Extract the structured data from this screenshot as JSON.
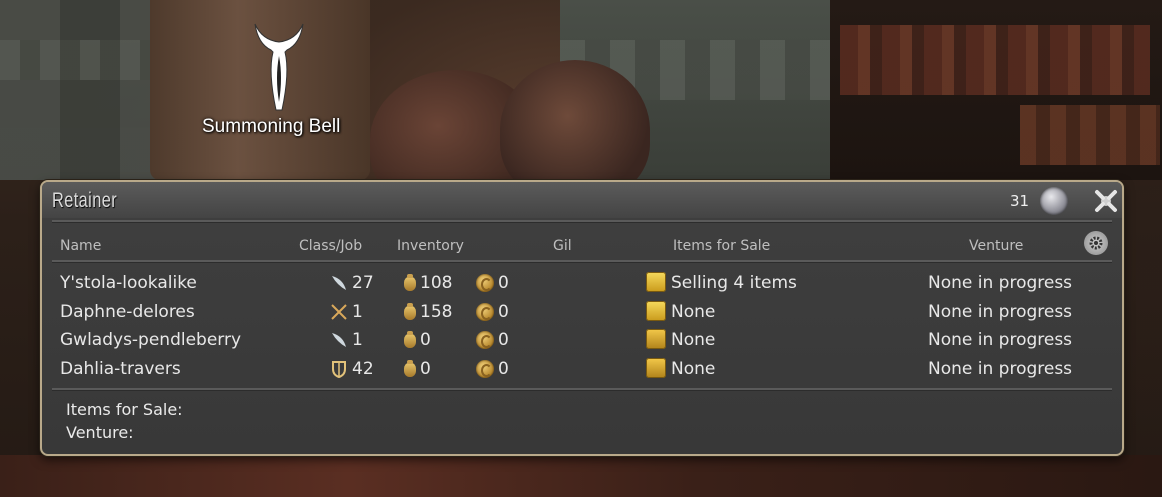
{
  "world": {
    "npc_label": "Summoning Bell"
  },
  "window": {
    "title": "Retainer",
    "retainer_count": "31",
    "icons": {
      "close": "close-icon",
      "coin": "silver-coin-icon",
      "settings": "gear-icon"
    },
    "columns": {
      "name": "Name",
      "class_job": "Class/Job",
      "inventory": "Inventory",
      "gil": "Gil",
      "items_for_sale": "Items for Sale",
      "venture": "Venture"
    },
    "rows": [
      {
        "name": "Y'stola-lookalike",
        "job_icon": "quill-icon",
        "level": "27",
        "inventory": "108",
        "gil": "0",
        "sale_icon": "market-icon",
        "items_for_sale": "Selling 4 items",
        "venture": "None in progress"
      },
      {
        "name": "Daphne-delores",
        "job_icon": "crossed-swords-icon",
        "level": "1",
        "inventory": "158",
        "gil": "0",
        "sale_icon": "market-icon",
        "items_for_sale": "None",
        "venture": "None in progress"
      },
      {
        "name": "Gwladys-pendleberry",
        "job_icon": "quill-icon",
        "level": "1",
        "inventory": "0",
        "gil": "0",
        "sale_icon": "scale-icon",
        "items_for_sale": "None",
        "venture": "None in progress"
      },
      {
        "name": "Dahlia-travers",
        "job_icon": "shield-icon",
        "level": "42",
        "inventory": "0",
        "gil": "0",
        "sale_icon": "scale-icon",
        "items_for_sale": "None",
        "venture": "None in progress"
      }
    ],
    "footer": {
      "items_for_sale_label": "Items for Sale:",
      "venture_label": "Venture:"
    }
  },
  "colors": {
    "window_border": "#b9a98a",
    "window_bg": "#3c3c3c",
    "text": "#e8e8e8",
    "header_text": "#bfbfbf",
    "gold": "#d8b04a"
  }
}
